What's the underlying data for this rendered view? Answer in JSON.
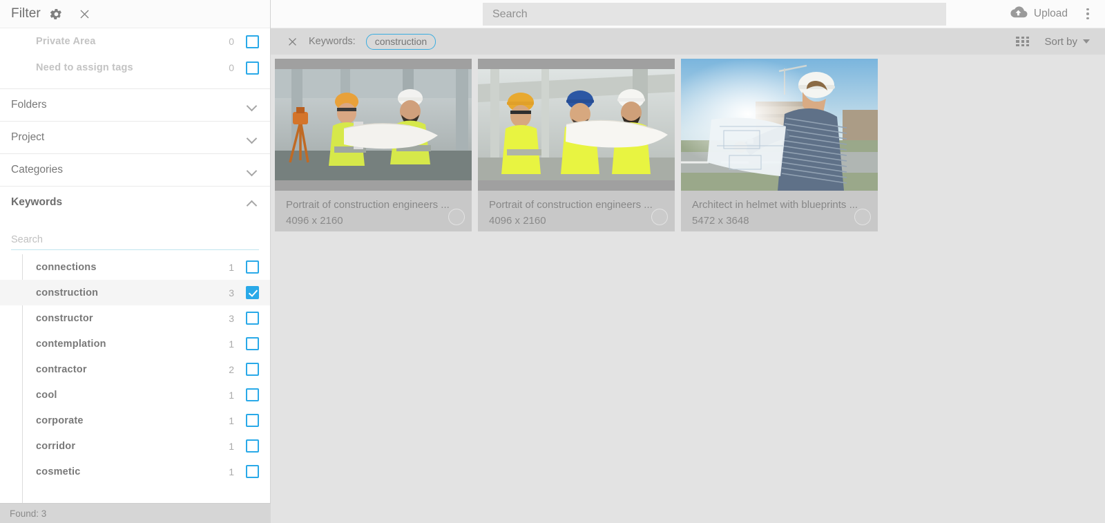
{
  "sidebar": {
    "header": {
      "title": "Filter",
      "gear_icon": "gear-icon",
      "close_icon": "close-icon"
    },
    "quick_filters": [
      {
        "label": "Private Area",
        "count": "0",
        "checked": false
      },
      {
        "label": "Need to assign tags",
        "count": "0",
        "checked": false
      }
    ],
    "sections": [
      {
        "label": "Folders",
        "expanded": false
      },
      {
        "label": "Project",
        "expanded": false
      },
      {
        "label": "Categories",
        "expanded": false
      },
      {
        "label": "Keywords",
        "expanded": true
      }
    ],
    "keyword_search": {
      "value": "",
      "placeholder": "Search"
    },
    "keywords": [
      {
        "label": "connections",
        "count": "1",
        "checked": false,
        "selected": false
      },
      {
        "label": "construction",
        "count": "3",
        "checked": true,
        "selected": true
      },
      {
        "label": "constructor",
        "count": "3",
        "checked": false,
        "selected": false
      },
      {
        "label": "contemplation",
        "count": "1",
        "checked": false,
        "selected": false
      },
      {
        "label": "contractor",
        "count": "2",
        "checked": false,
        "selected": false
      },
      {
        "label": "cool",
        "count": "1",
        "checked": false,
        "selected": false
      },
      {
        "label": "corporate",
        "count": "1",
        "checked": false,
        "selected": false
      },
      {
        "label": "corridor",
        "count": "1",
        "checked": false,
        "selected": false
      },
      {
        "label": "cosmetic",
        "count": "1",
        "checked": false,
        "selected": false
      }
    ],
    "status": "Found: 3"
  },
  "topbar": {
    "search": {
      "value": "",
      "placeholder": "Search"
    },
    "upload_label": "Upload",
    "upload_icon": "cloud-upload-icon",
    "overflow_icon": "kebab-menu-icon"
  },
  "filterbar": {
    "clear_icon": "close-icon",
    "label": "Keywords:",
    "chips": [
      "construction"
    ],
    "view_icon": "grid-view-icon",
    "sort_label": "Sort by",
    "sort_caret_icon": "caret-down-icon"
  },
  "results": {
    "items": [
      {
        "title": "Portrait of construction engineers ...",
        "dimensions": "4096 x 2160",
        "letterboxed": true
      },
      {
        "title": "Portrait of construction engineers ...",
        "dimensions": "4096 x 2160",
        "letterboxed": true
      },
      {
        "title": "Architect in helmet with blueprints ...",
        "dimensions": "5472 x 3648",
        "letterboxed": false
      }
    ]
  },
  "colors": {
    "accent": "#29a9e8",
    "chip_border": "#3aade0",
    "content_bg": "#e3e3e3",
    "card_bg": "#c8c8c8",
    "thumb_bg": "#a0a0a0",
    "filterbar_bg": "#d9d9d9",
    "statusbar_bg": "#d6d6d6"
  }
}
